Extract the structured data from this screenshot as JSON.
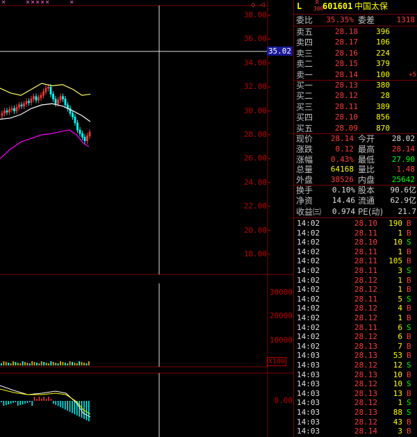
{
  "stock": {
    "marker": "L",
    "r_label": "R",
    "index_label": "300",
    "code": "601601",
    "name": "中国太保"
  },
  "header": {
    "webi_label": "委比",
    "webi_value": "35.35%",
    "weicha_label": "委差",
    "weicha_value": "1318"
  },
  "sell_orders": [
    {
      "label": "卖五",
      "price": "28.18",
      "vol": "396",
      "extra": ""
    },
    {
      "label": "卖四",
      "price": "28.17",
      "vol": "106",
      "extra": ""
    },
    {
      "label": "卖三",
      "price": "28.16",
      "vol": "224",
      "extra": ""
    },
    {
      "label": "卖二",
      "price": "28.15",
      "vol": "379",
      "extra": ""
    },
    {
      "label": "卖一",
      "price": "28.14",
      "vol": "100",
      "extra": "+5"
    }
  ],
  "buy_orders": [
    {
      "label": "买一",
      "price": "28.13",
      "vol": "380"
    },
    {
      "label": "买二",
      "price": "28.12",
      "vol": "28"
    },
    {
      "label": "买三",
      "price": "28.11",
      "vol": "389"
    },
    {
      "label": "买四",
      "price": "28.10",
      "vol": "856"
    },
    {
      "label": "买五",
      "price": "28.09",
      "vol": "870"
    }
  ],
  "stats": [
    {
      "l1": "现价",
      "v1": "28.14",
      "l2": "今开",
      "v2": "28.02",
      "c1": "red",
      "c2": "white"
    },
    {
      "l1": "涨跌",
      "v1": "0.12",
      "l2": "最高",
      "v2": "28.14",
      "c1": "red",
      "c2": "red"
    },
    {
      "l1": "涨幅",
      "v1": "0.43%",
      "l2": "最低",
      "v2": "27.90",
      "c1": "red",
      "c2": "green"
    },
    {
      "l1": "总量",
      "v1": "64168",
      "l2": "量比",
      "v2": "1.48",
      "c1": "yellow",
      "c2": "red"
    },
    {
      "l1": "外盘",
      "v1": "38526",
      "l2": "内盘",
      "v2": "25642",
      "c1": "red",
      "c2": "green"
    }
  ],
  "fundamentals": [
    {
      "l1": "换手",
      "v1": "0.10%",
      "l2": "股本",
      "v2": "90.6亿"
    },
    {
      "l1": "净资",
      "v1": "14.46",
      "l2": "流通",
      "v2": "62.9亿"
    },
    {
      "l1": "收益㈢",
      "v1": "0.974",
      "l2": "PE(动)",
      "v2": "21.7"
    }
  ],
  "trades": [
    {
      "time": "14:02",
      "price": "28.10",
      "vol": "190",
      "side": "B"
    },
    {
      "time": "14:02",
      "price": "28.11",
      "vol": "1",
      "side": "B"
    },
    {
      "time": "14:02",
      "price": "28.10",
      "vol": "10",
      "side": "S"
    },
    {
      "time": "14:02",
      "price": "28.11",
      "vol": "1",
      "side": "B"
    },
    {
      "time": "14:02",
      "price": "28.11",
      "vol": "105",
      "side": "B"
    },
    {
      "time": "14:02",
      "price": "28.11",
      "vol": "3",
      "side": "S"
    },
    {
      "time": "14:02",
      "price": "28.12",
      "vol": "1",
      "side": "B"
    },
    {
      "time": "14:02",
      "price": "28.12",
      "vol": "1",
      "side": "B"
    },
    {
      "time": "14:02",
      "price": "28.11",
      "vol": "5",
      "side": "S"
    },
    {
      "time": "14:02",
      "price": "28.12",
      "vol": "4",
      "side": "B"
    },
    {
      "time": "14:02",
      "price": "28.12",
      "vol": "1",
      "side": "B"
    },
    {
      "time": "14:02",
      "price": "28.11",
      "vol": "6",
      "side": "S"
    },
    {
      "time": "14:02",
      "price": "28.12",
      "vol": "6",
      "side": "B"
    },
    {
      "time": "14:02",
      "price": "28.13",
      "vol": "7",
      "side": "B"
    },
    {
      "time": "14:03",
      "price": "28.13",
      "vol": "53",
      "side": "B"
    },
    {
      "time": "14:03",
      "price": "28.12",
      "vol": "12",
      "side": "S"
    },
    {
      "time": "14:03",
      "price": "28.13",
      "vol": "10",
      "side": "B"
    },
    {
      "time": "14:03",
      "price": "28.12",
      "vol": "10",
      "side": "S"
    },
    {
      "time": "14:03",
      "price": "28.13",
      "vol": "13",
      "side": "B"
    },
    {
      "time": "14:03",
      "price": "28.12",
      "vol": "1",
      "side": "S"
    },
    {
      "time": "14:03",
      "price": "28.13",
      "vol": "88",
      "side": "S"
    },
    {
      "time": "14:03",
      "price": "28.12",
      "vol": "43",
      "side": "B"
    },
    {
      "time": "14:03",
      "price": "28.14",
      "vol": "3",
      "side": "B"
    }
  ],
  "chart_data": {
    "type": "candlestick",
    "price_axis_ticks": [
      "38.00",
      "36.00",
      "34.00",
      "32.00",
      "30.00",
      "28.00",
      "26.00",
      "24.00",
      "22.00",
      "20.00",
      "18.00"
    ],
    "crosshair_price": "35.02",
    "volume_axis_ticks": [
      "30000",
      "20000",
      "10000"
    ],
    "volume_unit": "X100",
    "macd_axis_ticks": [
      "0.00"
    ],
    "ylim": [
      16.5,
      39
    ]
  },
  "colors": {
    "up": "#ff3b3b",
    "down": "#00ffff",
    "ma_yellow": "#ffff66",
    "ma_white": "#ffffff",
    "ma_magenta": "#ff00ff",
    "grid": "#7a0000"
  },
  "icons": {
    "toolbar_marks": "pink-x-markers",
    "diamond": "diamond-icon"
  }
}
